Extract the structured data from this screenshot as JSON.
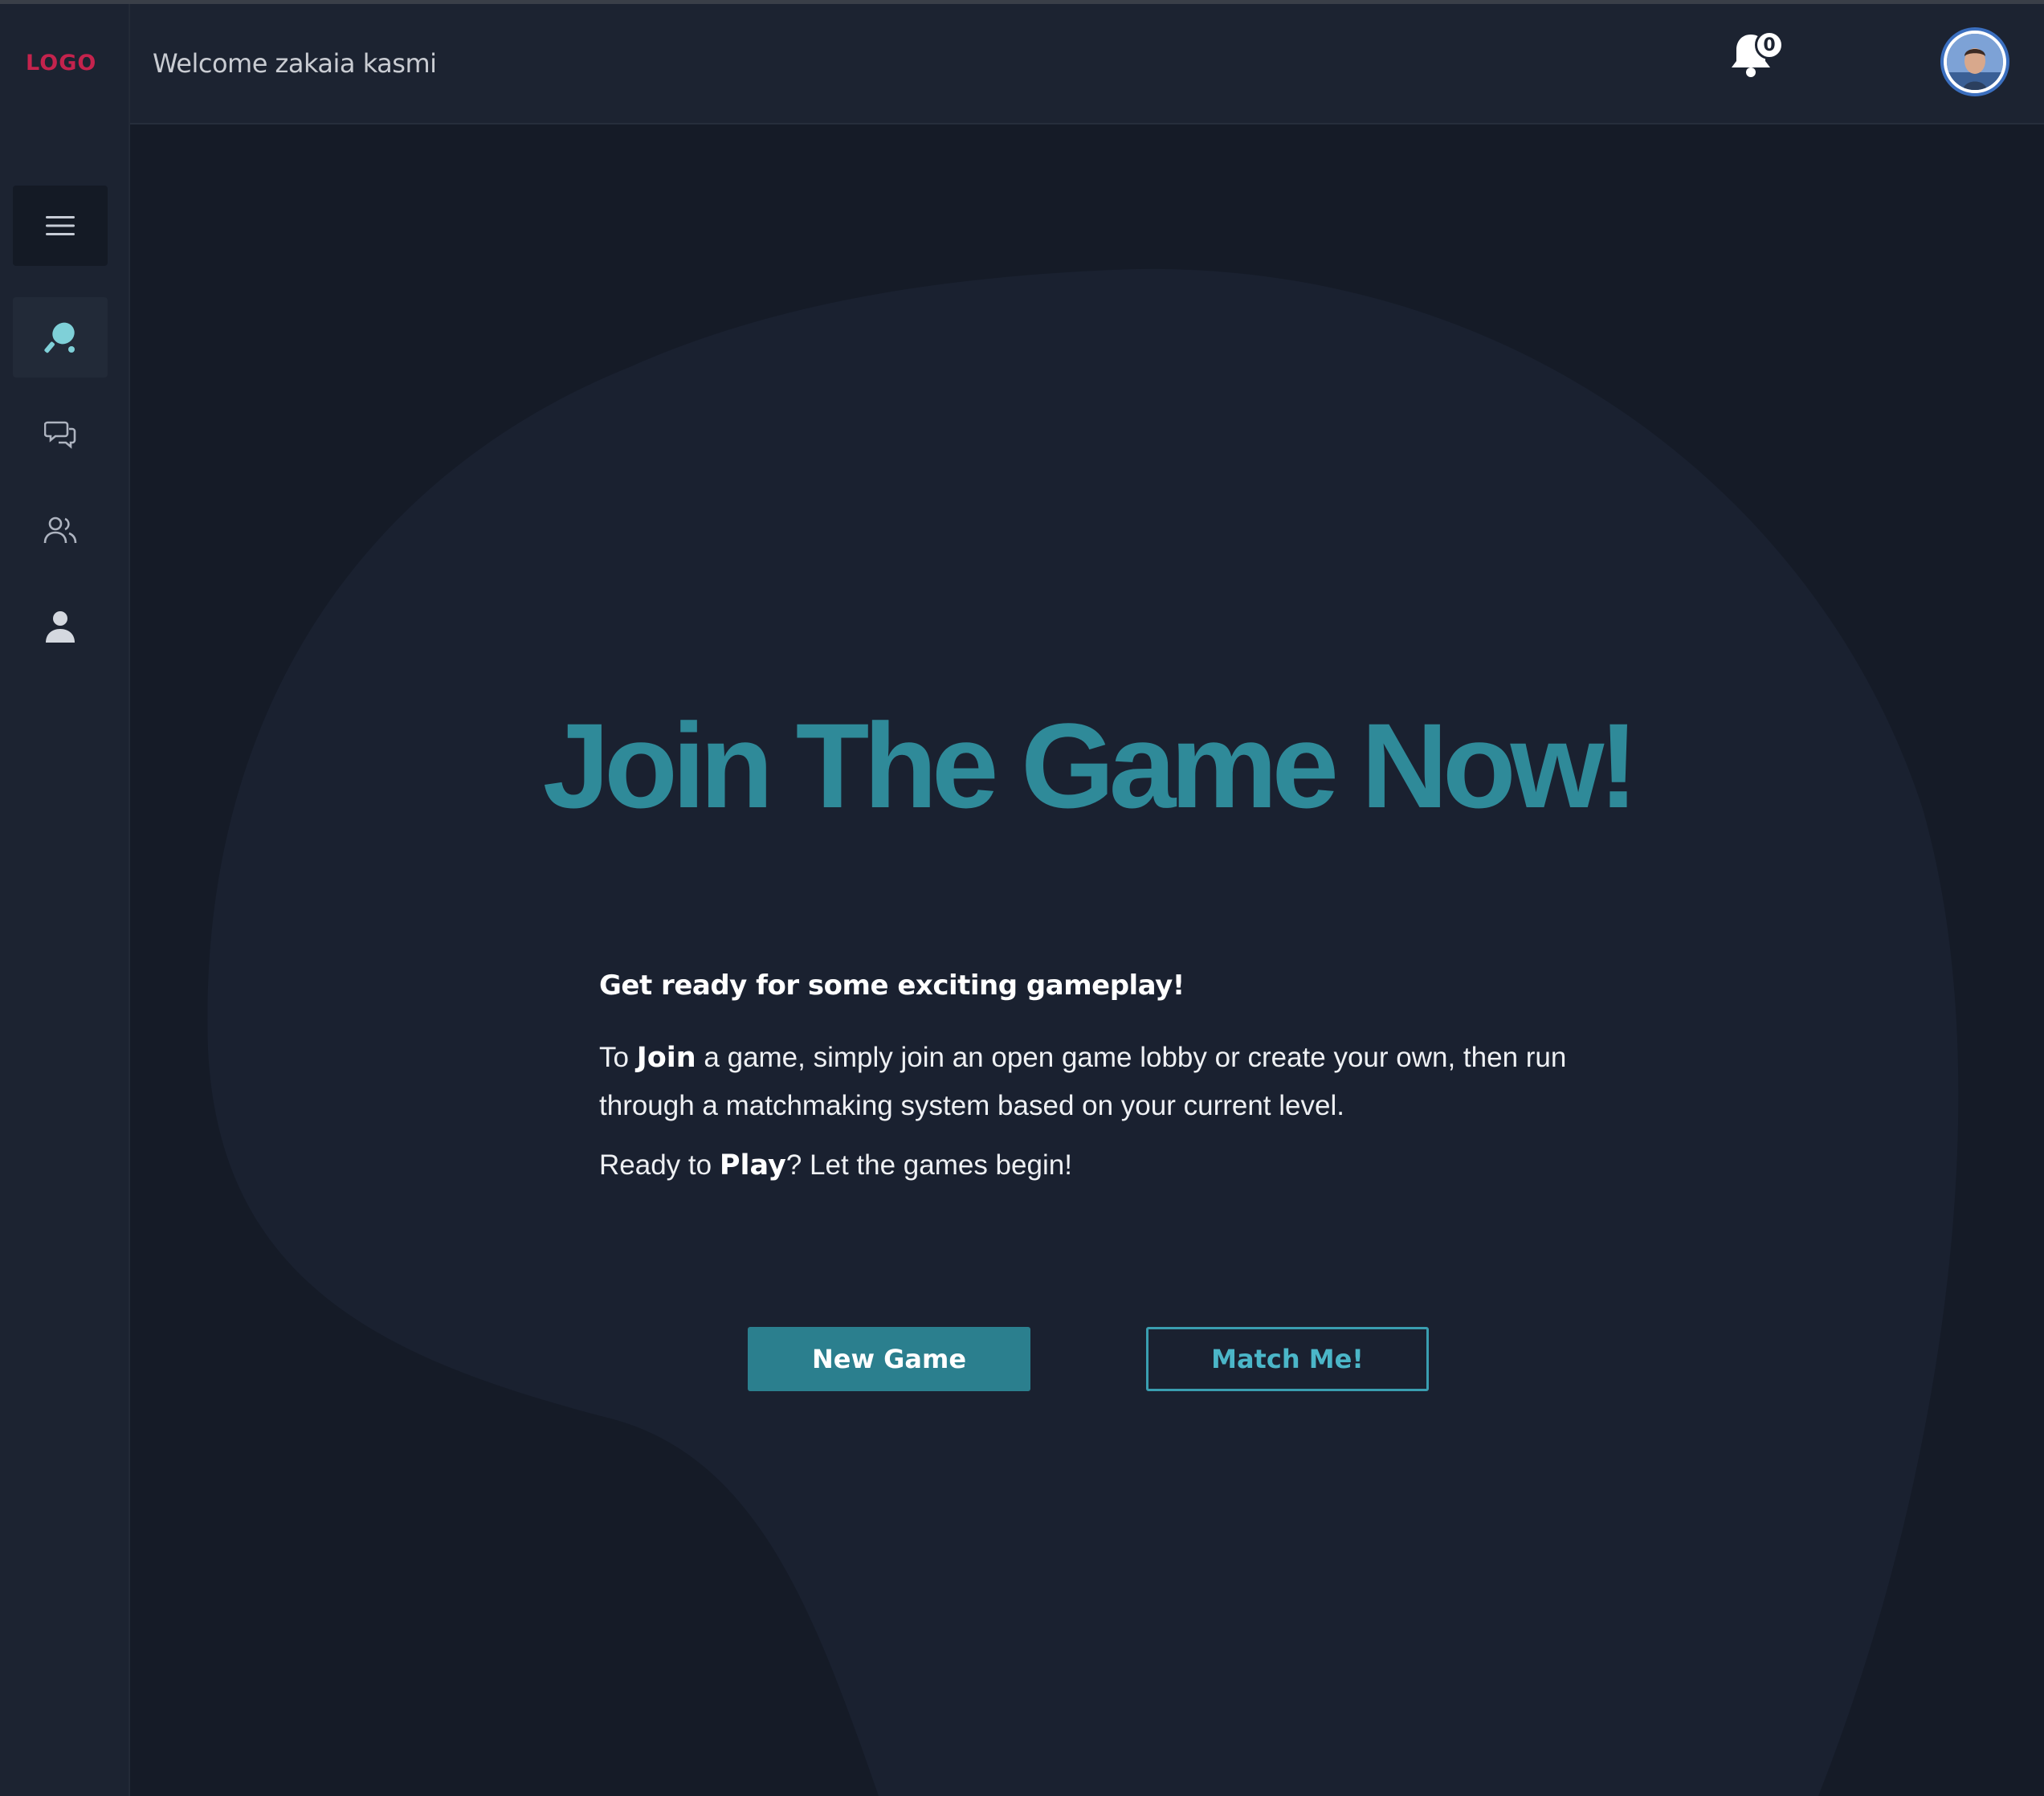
{
  "app": {
    "logo_text": "LOGO",
    "logo_color": "#c4234d",
    "accent": "#2f8a99"
  },
  "header": {
    "welcome": "Welcome zakaia kasmi",
    "notification_count": "0"
  },
  "sidebar": {
    "items": [
      {
        "name": "menu",
        "icon": "hamburger-icon"
      },
      {
        "name": "game",
        "icon": "ping-pong-icon",
        "active": true
      },
      {
        "name": "chat",
        "icon": "chat-icon"
      },
      {
        "name": "friends",
        "icon": "users-icon"
      },
      {
        "name": "profile",
        "icon": "user-icon"
      }
    ]
  },
  "main": {
    "title": "Join The Game Now!",
    "subtitle": "Get ready for some exciting gameplay!",
    "para1": {
      "pre": "To ",
      "bold": "Join",
      "post": " a game, simply join an open game lobby or create your own, then run through a matchmaking system based on your current level."
    },
    "para2": {
      "pre": "Ready to ",
      "bold": "Play",
      "post": "? Let the games begin!"
    },
    "buttons": {
      "new_game": "New Game",
      "match_me": "Match Me!"
    }
  }
}
